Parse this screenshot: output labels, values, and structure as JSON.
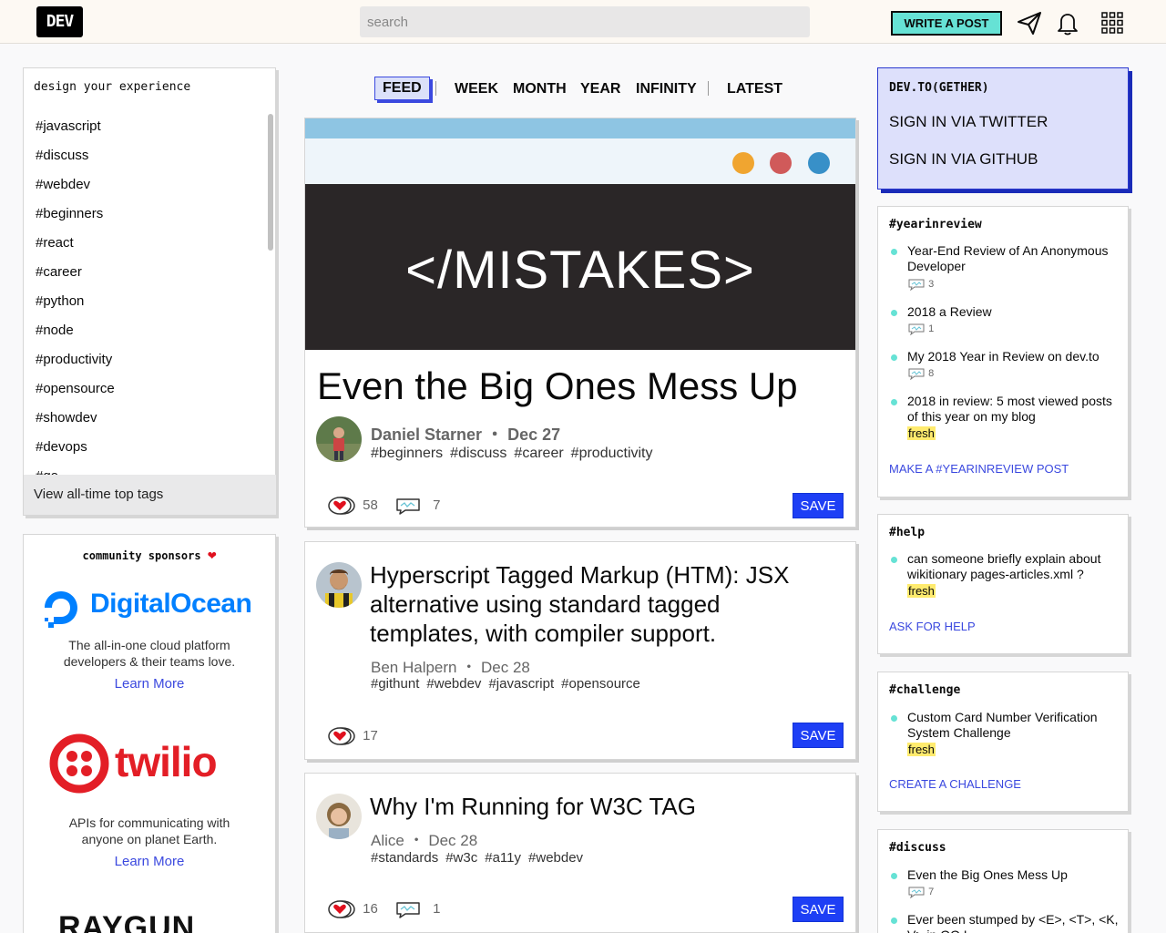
{
  "header": {
    "logo": "DEV",
    "search_placeholder": "search",
    "write_post": "WRITE A POST",
    "icons": [
      "connect-icon",
      "notifications-icon",
      "apps-menu-icon"
    ]
  },
  "sidebar": {
    "title": "design your experience",
    "tags": [
      "#javascript",
      "#discuss",
      "#webdev",
      "#beginners",
      "#react",
      "#career",
      "#python",
      "#node",
      "#productivity",
      "#opensource",
      "#showdev",
      "#devops",
      "#go"
    ],
    "footer": "View all-time top tags"
  },
  "sponsors": {
    "title": "community sponsors",
    "items": [
      {
        "name": "DigitalOcean",
        "desc_line1": "The all-in-one cloud platform",
        "desc_line2": "developers & their teams love.",
        "link": "Learn More",
        "color": "#0080ff"
      },
      {
        "name": "twilio",
        "desc_line1": "APIs for communicating with",
        "desc_line2": "anyone on planet Earth.",
        "link": "Learn More",
        "color": "#e31e26"
      },
      {
        "name": "RAYGUN"
      }
    ]
  },
  "feed_nav": {
    "items": [
      "FEED",
      "WEEK",
      "MONTH",
      "YEAR",
      "INFINITY",
      "LATEST"
    ],
    "active": "FEED"
  },
  "posts": [
    {
      "cover_text": "</MISTAKES>",
      "title": "Even the Big Ones Mess Up",
      "author": "Daniel Starner",
      "date": "Dec 27",
      "tags": [
        "#beginners",
        "#discuss",
        "#career",
        "#productivity"
      ],
      "reactions": "58",
      "comments": "7",
      "save": "SAVE"
    },
    {
      "title": "Hyperscript Tagged Markup (HTM): JSX alternative using standard tagged templates, with compiler support.",
      "author": "Ben Halpern",
      "date": "Dec 28",
      "tags": [
        "#githunt",
        "#webdev",
        "#javascript",
        "#opensource"
      ],
      "reactions": "17",
      "save": "SAVE"
    },
    {
      "title": "Why I'm Running for W3C TAG",
      "author": "Alice",
      "date": "Dec 28",
      "tags": [
        "#standards",
        "#w3c",
        "#a11y",
        "#webdev"
      ],
      "reactions": "16",
      "comments": "1",
      "save": "SAVE"
    }
  ],
  "gether": {
    "title": "DEV.TO(GETHER)",
    "twitter": "SIGN IN VIA TWITTER",
    "github": "SIGN IN VIA GITHUB"
  },
  "widgets": [
    {
      "tag": "#yearinreview",
      "items": [
        {
          "title": "Year-End Review of An Anonymous Developer",
          "count": "3"
        },
        {
          "title": "2018 a Review",
          "count": "1"
        },
        {
          "title": "My 2018 Year in Review on dev.to",
          "count": "8"
        },
        {
          "title": "2018 in review: 5 most viewed posts of this year on my blog",
          "fresh": "fresh"
        }
      ],
      "cta": "MAKE A #YEARINREVIEW POST"
    },
    {
      "tag": "#help",
      "items": [
        {
          "title": "can someone briefly explain about wikitionary pages-articles.xml ?",
          "fresh": "fresh"
        }
      ],
      "cta": "ASK FOR HELP"
    },
    {
      "tag": "#challenge",
      "items": [
        {
          "title": "Custom Card Number Verification System Challenge",
          "fresh": "fresh"
        }
      ],
      "cta": "CREATE A CHALLENGE"
    },
    {
      "tag": "#discuss",
      "items": [
        {
          "title": "Even the Big Ones Mess Up",
          "count": "7"
        },
        {
          "title": "Ever been stumped by <E>, <T>, <K, V> in OO L..."
        }
      ]
    }
  ],
  "colors": {
    "accent": "#3b49df",
    "mint": "#66e2d5",
    "save": "#1e3ff5",
    "fresh": "#ffeb6e"
  }
}
